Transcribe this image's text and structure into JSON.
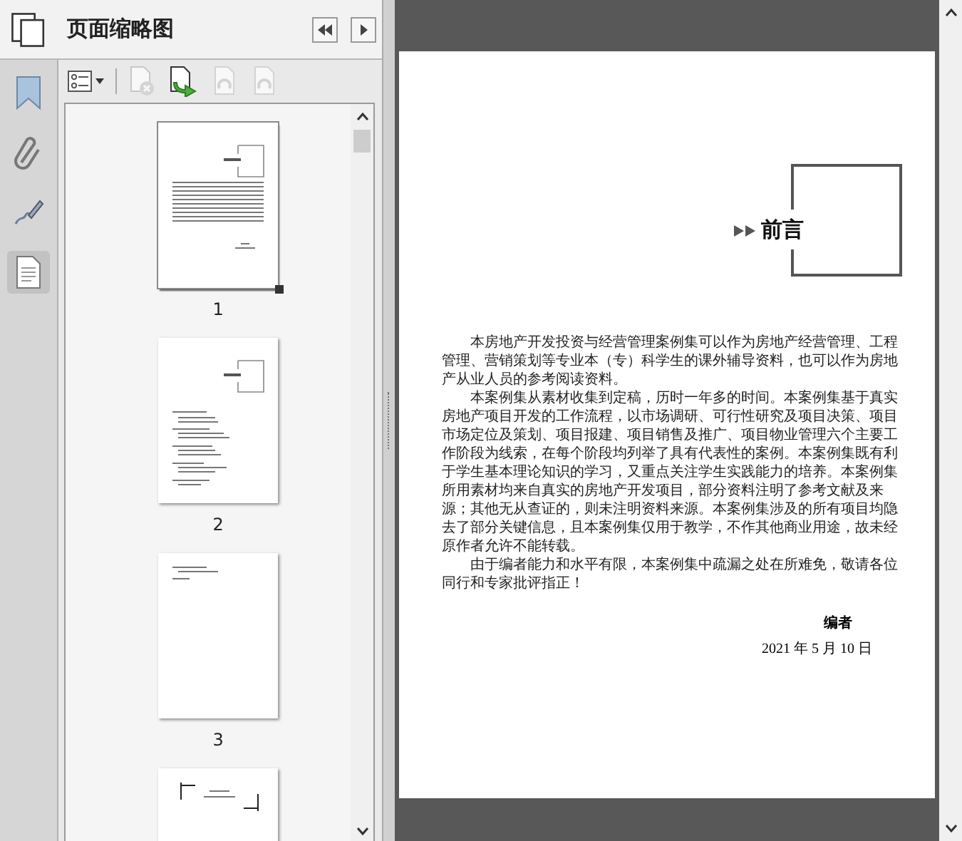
{
  "panel": {
    "title": "页面缩略图"
  },
  "side_tabs": [
    {
      "kind": "bookmarks",
      "selected": false
    },
    {
      "kind": "attachments",
      "selected": false
    },
    {
      "kind": "signatures",
      "selected": false
    },
    {
      "kind": "pages",
      "selected": true
    }
  ],
  "toolbar": [
    {
      "kind": "options",
      "disabled": false
    },
    {
      "kind": "delete",
      "disabled": true
    },
    {
      "kind": "insert",
      "disabled": false
    },
    {
      "kind": "undo",
      "disabled": true
    },
    {
      "kind": "redo",
      "disabled": true
    }
  ],
  "thumbnails": [
    {
      "kind": "preface",
      "label": "1",
      "selected": true
    },
    {
      "kind": "contents",
      "label": "2",
      "selected": false
    },
    {
      "kind": "contents-end",
      "label": "3",
      "selected": false
    },
    {
      "kind": "chapter",
      "selected": false
    }
  ],
  "page": {
    "heading": "前言",
    "paragraphs": [
      "本房地产开发投资与经营管理案例集可以作为房地产经营管理、工程管理、营销策划等专业本（专）科学生的课外辅导资料，也可以作为房地产从业人员的参考阅读资料。",
      "本案例集从素材收集到定稿，历时一年多的时间。本案例集基于真实房地产项目开发的工作流程，以市场调研、可行性研究及项目决策、项目市场定位及策划、项目报建、项目销售及推广、项目物业管理六个主要工作阶段为线索，在每个阶段均列举了具有代表性的案例。本案例集既有利于学生基本理论知识的学习，又重点关注学生实践能力的培养。本案例集所用素材均来自真实的房地产开发项目，部分资料注明了参考文献及来源；其他无从查证的，则未注明资料来源。本案例集涉及的所有项目均隐去了部分关键信息，且本案例集仅用于教学，不作其他商业用途，故未经原作者允许不能转载。",
      "由于编者能力和水平有限，本案例集中疏漏之处在所难免，敬请各位同行和专家批评指正！"
    ],
    "signature": "编者",
    "date": "2021 年 5 月 10 日"
  }
}
